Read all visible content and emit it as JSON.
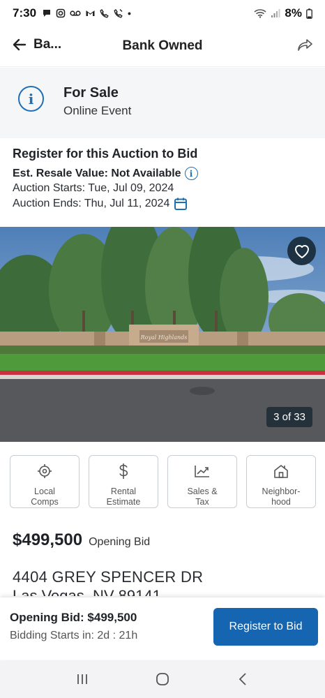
{
  "status_bar": {
    "time": "7:30",
    "battery": "8%",
    "notification_icons": [
      "chat-bubble-icon",
      "instagram-icon",
      "voicemail-icon",
      "gmail-icon",
      "missed-call-icon",
      "phone-icon",
      "dot-icon"
    ]
  },
  "header": {
    "back_label": "Ba...",
    "title": "Bank Owned"
  },
  "sale_banner": {
    "status": "For Sale",
    "event_type": "Online Event"
  },
  "auction": {
    "register_heading": "Register for this Auction to Bid",
    "resale_value": "Est. Resale Value: Not Available",
    "starts": "Auction Starts: Tue, Jul 09, 2024",
    "ends": "Auction Ends: Thu, Jul 11, 2024"
  },
  "photo": {
    "counter": "3 of 33",
    "sign_text": "Royal Highlands"
  },
  "tiles": [
    {
      "label": "Local\nComps",
      "icon": "target-icon"
    },
    {
      "label": "Rental\nEstimate",
      "icon": "dollar-icon"
    },
    {
      "label": "Sales &\nTax",
      "icon": "trend-chart-icon"
    },
    {
      "label": "Neighbor-\nhood",
      "icon": "house-icon"
    }
  ],
  "listing": {
    "price": "$499,500",
    "price_label": "Opening Bid",
    "address": "4404 GREY SPENCER DR",
    "city": "Las Vegas, NV 89141"
  },
  "bottom_bar": {
    "opening_bid": "Opening Bid: $499,500",
    "bidding_starts": "Bidding Starts in: 2d : 21h",
    "register_button": "Register to Bid"
  },
  "colors": {
    "accent": "#1565b0",
    "info_blue": "#1f6fb2",
    "banner_bg": "#f4f6f8",
    "fav_bg": "#1d3344"
  }
}
